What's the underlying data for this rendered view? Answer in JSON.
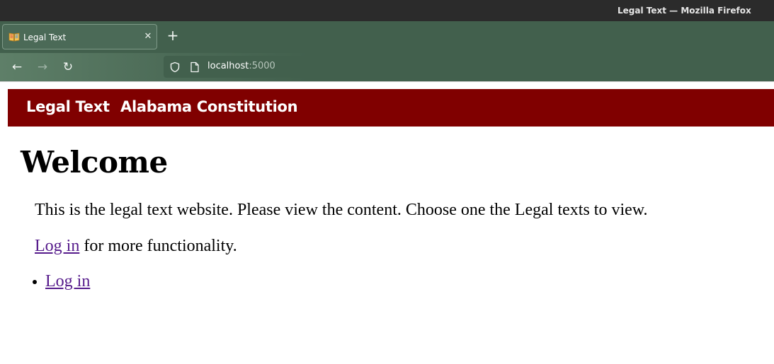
{
  "window": {
    "title": "Legal Text — Mozilla Firefox"
  },
  "tabs": [
    {
      "title": "Legal Text",
      "close_glyph": "✕"
    }
  ],
  "newtab_glyph": "+",
  "toolbar": {
    "back_glyph": "←",
    "forward_glyph": "→",
    "reload_glyph": "↻",
    "url_host": "localhost",
    "url_port": ":5000"
  },
  "site": {
    "brand": "Legal Text",
    "nav_link": "Alabama Constitution",
    "nav_bg": "#800000"
  },
  "content": {
    "heading": "Welcome",
    "intro": "This is the legal text website. Please view the content. Choose one the Legal texts to view.",
    "login_link": "Log in",
    "login_suffix": " for more functionality.",
    "list_items": [
      "Log in"
    ],
    "link_color": "#551a8b"
  }
}
